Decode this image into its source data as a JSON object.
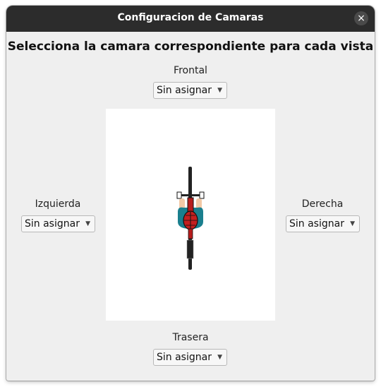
{
  "window": {
    "title": "Configuracion de Camaras",
    "close_label": "×"
  },
  "heading": "Selecciona la camara correspondiente para cada vista",
  "views": {
    "front": {
      "label": "Frontal",
      "value": "Sin asignar"
    },
    "left": {
      "label": "Izquierda",
      "value": "Sin asignar"
    },
    "right": {
      "label": "Derecha",
      "value": "Sin asignar"
    },
    "rear": {
      "label": "Trasera",
      "value": "Sin asignar"
    }
  },
  "icons": {
    "dropdown": "▼"
  },
  "colors": {
    "titlebar": "#2c2c2c",
    "window_bg": "#efefef",
    "jersey": "#1a7f8e",
    "helmet": "#c41f1f"
  }
}
